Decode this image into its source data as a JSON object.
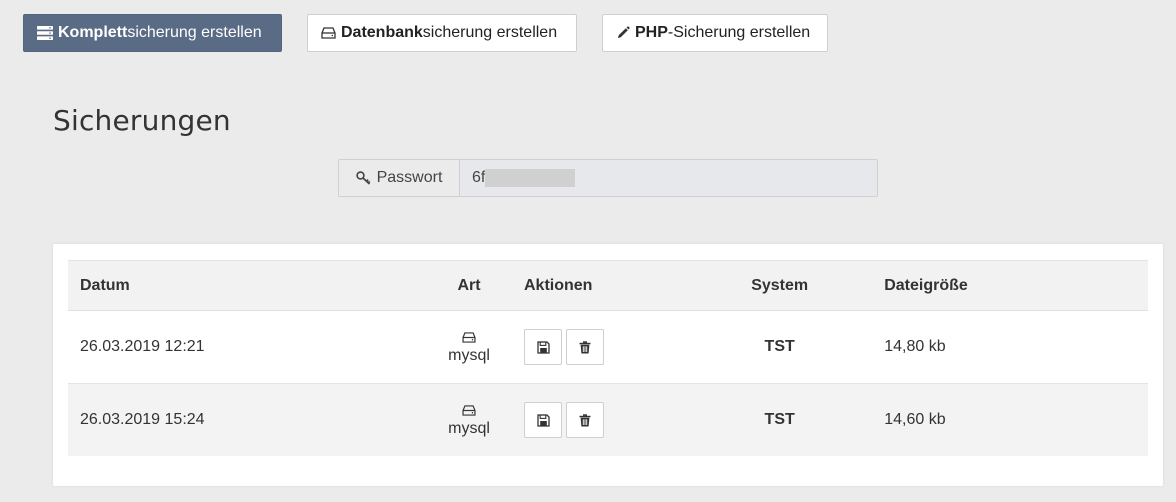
{
  "toolbar": {
    "full_backup": {
      "bold": "Komplett",
      "rest": "sicherung erstellen",
      "icon": "server-icon"
    },
    "db_backup": {
      "bold": "Datenbank",
      "rest": "sicherung erstellen",
      "icon": "hdd-icon"
    },
    "php_backup": {
      "bold": "PHP",
      "rest": "-Sicherung erstellen",
      "icon": "pencil-icon"
    }
  },
  "page": {
    "title": "Sicherungen"
  },
  "password": {
    "label": "Passwort",
    "value": "6f",
    "icon": "key-icon"
  },
  "table": {
    "headers": [
      "Datum",
      "Art",
      "Aktionen",
      "System",
      "Dateigröße"
    ],
    "rows": [
      {
        "datum": "26.03.2019 12:21",
        "art": "mysql",
        "system": "TST",
        "size": "14,80 kb"
      },
      {
        "datum": "26.03.2019 15:24",
        "art": "mysql",
        "system": "TST",
        "size": "14,60 kb"
      }
    ]
  },
  "colors": {
    "primary_button": "#5a6b85",
    "background": "#ebebeb"
  }
}
